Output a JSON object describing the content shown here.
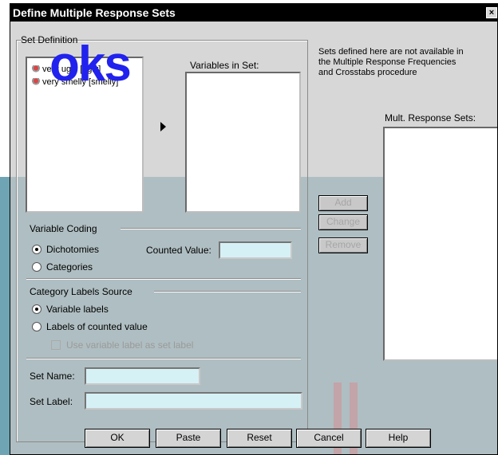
{
  "dialog": {
    "title": "Define Multiple Response Sets",
    "close": "×"
  },
  "watermark": "oks",
  "set_definition": {
    "title": "Set Definition",
    "variables": [
      "very ugly [ugly]",
      "very smelly [smelly]"
    ],
    "variables_in_set_label": "Variables in Set:"
  },
  "note": [
    "Sets defined here are not available in",
    "the Multiple Response Frequencies",
    "and Crosstabs procedure"
  ],
  "mult_response_sets_label": "Mult. Response Sets:",
  "buttons_side": {
    "add": "Add",
    "change": "Change",
    "remove": "Remove"
  },
  "variable_coding": {
    "title": "Variable Coding",
    "dichotomies": "Dichotomies",
    "categories": "Categories",
    "counted_value_label": "Counted Value:",
    "counted_value": ""
  },
  "category_labels_source": {
    "title": "Category Labels Source",
    "variable_labels": "Variable labels",
    "labels_counted": "Labels of counted value",
    "use_variable_label": "Use variable label as set label"
  },
  "set_name_label": "Set Name:",
  "set_name_value": "",
  "set_label_label": "Set Label:",
  "set_label_value": "",
  "bottom_buttons": {
    "ok": "OK",
    "paste": "Paste",
    "reset": "Reset",
    "cancel": "Cancel",
    "help": "Help"
  }
}
